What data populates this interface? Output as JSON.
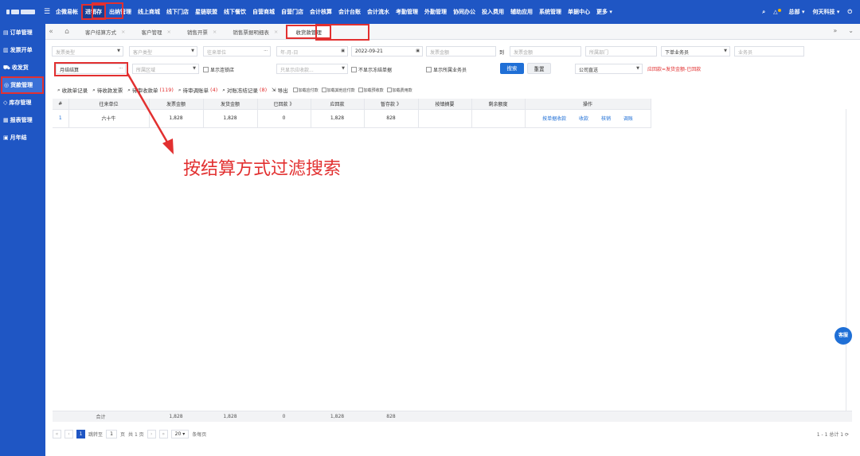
{
  "topbar": {
    "nav": [
      "企微易帐",
      "进销存",
      "出纳管理",
      "线上商城",
      "线下门店",
      "星链联盟",
      "线下餐饮",
      "自营商城",
      "自营门店",
      "会计核算",
      "会计台账",
      "会计流水",
      "考勤管理",
      "外勤管理",
      "协同办公",
      "投入费用",
      "辅助应用",
      "系统管理",
      "单据中心",
      "更多 ▾"
    ],
    "active_index": 1,
    "user": "总部 ▾",
    "company": "何天科技 ▾"
  },
  "sidebar": {
    "items": [
      {
        "icon": "clipboard-icon",
        "label": "订单管理"
      },
      {
        "icon": "invoice-icon",
        "label": "发票开单"
      },
      {
        "icon": "truck-icon",
        "label": "收发货"
      },
      {
        "icon": "money-icon",
        "label": "货款管理"
      },
      {
        "icon": "warehouse-icon",
        "label": "库存管理"
      },
      {
        "icon": "report-icon",
        "label": "报表管理"
      },
      {
        "icon": "calendar-icon",
        "label": "月年结"
      }
    ],
    "active_index": 3
  },
  "tabs": [
    "客户结算方式",
    "客户管理",
    "销售开票",
    "销售票据明细表",
    "收货款管理"
  ],
  "active_tab": 4,
  "filters": {
    "invoice_type": "发票类型",
    "customer_type": "客户类型",
    "partner": "往来单位",
    "date_ph": "年-月-日",
    "date_val": "2022-09-21",
    "amount_from": "发票金额",
    "to_label": "到",
    "amount_to": "发票金额",
    "dept": "所属部门",
    "salesman_sub": "下单业务员",
    "salesman": "业务员",
    "settle": "月结结算",
    "region": "所属区域",
    "show_chain": "显示连锁店",
    "only_show": "只显示应收款...",
    "hide_frozen": "不显示冻结单据",
    "show_all_sales": "显示所属业务员",
    "search": "搜索",
    "reset": "重置",
    "company": "公司直送",
    "hint": "应回款=发货金额-已回款"
  },
  "toolbar": {
    "items": [
      "收款单记录",
      "待收款发票",
      "待审收款单",
      "待审调账单",
      "对账冻结记录",
      "导出"
    ],
    "count1": "(119)",
    "count2": "(4)",
    "count3": "(8)",
    "checks": [
      "加载应付款",
      "加载其他应付款",
      "加载预收款",
      "加载费用款"
    ]
  },
  "table": {
    "headers": [
      "#",
      "往来单位",
      "发票金额",
      "发货金额",
      "已回款 》",
      "应回款",
      "暂存款 》",
      "按镇摘要",
      "剩余额度",
      "操作"
    ],
    "rows": [
      {
        "idx": "1",
        "partner": "六十牛",
        "invoice": "1,828",
        "ship": "1,828",
        "returned": "0",
        "due": "1,828",
        "temp": "828",
        "summary": "",
        "remain": ""
      }
    ],
    "actions": [
      "按单据收款",
      "收款",
      "核销",
      "调账"
    ],
    "totals": {
      "label": "合计",
      "invoice": "1,828",
      "ship": "1,828",
      "returned": "0",
      "due": "1,828",
      "temp": "828"
    }
  },
  "pager": {
    "goto": "跳转至",
    "page": "1",
    "page_unit": "页",
    "total_pages": "共 1 页",
    "size": "20 ▾",
    "per": "条每页",
    "summary": "1 - 1 总计 1"
  },
  "annotation": "按结算方式过滤搜索",
  "service_label": "客服",
  "colors": {
    "primary": "#1f56c4",
    "highlight": "#e23030"
  }
}
